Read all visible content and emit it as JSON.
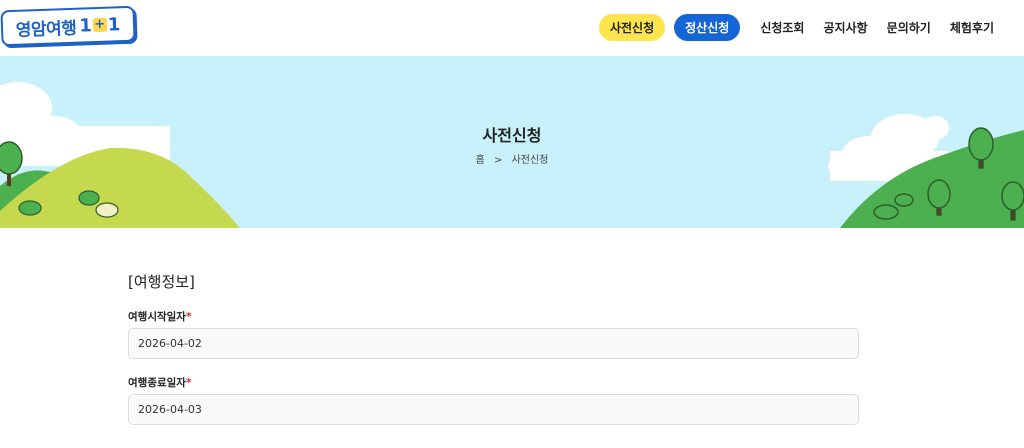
{
  "logo": {
    "text": "영암여행",
    "num_left": "1",
    "plus": "+",
    "num_right": "1"
  },
  "nav": {
    "pill_pre_apply": "사전신청",
    "pill_settlement": "정산신청",
    "links": [
      "신청조회",
      "공지사항",
      "문의하기",
      "체험후기"
    ]
  },
  "hero": {
    "title": "사전신청",
    "breadcrumb_home": "홈",
    "breadcrumb_sep": ">",
    "breadcrumb_current": "사전신청"
  },
  "form": {
    "section_title": "[여행정보]",
    "start_label": "여행시작일자",
    "start_value": "2026-04-02",
    "end_label": "여행종료일자",
    "end_value": "2026-04-03",
    "required_mark": "*"
  },
  "colors": {
    "brand_blue": "#1466d6",
    "brand_yellow": "#ffe44d",
    "sky": "#c8f1fb",
    "hill_light": "#c5d94f",
    "hill_green": "#4caf50"
  }
}
